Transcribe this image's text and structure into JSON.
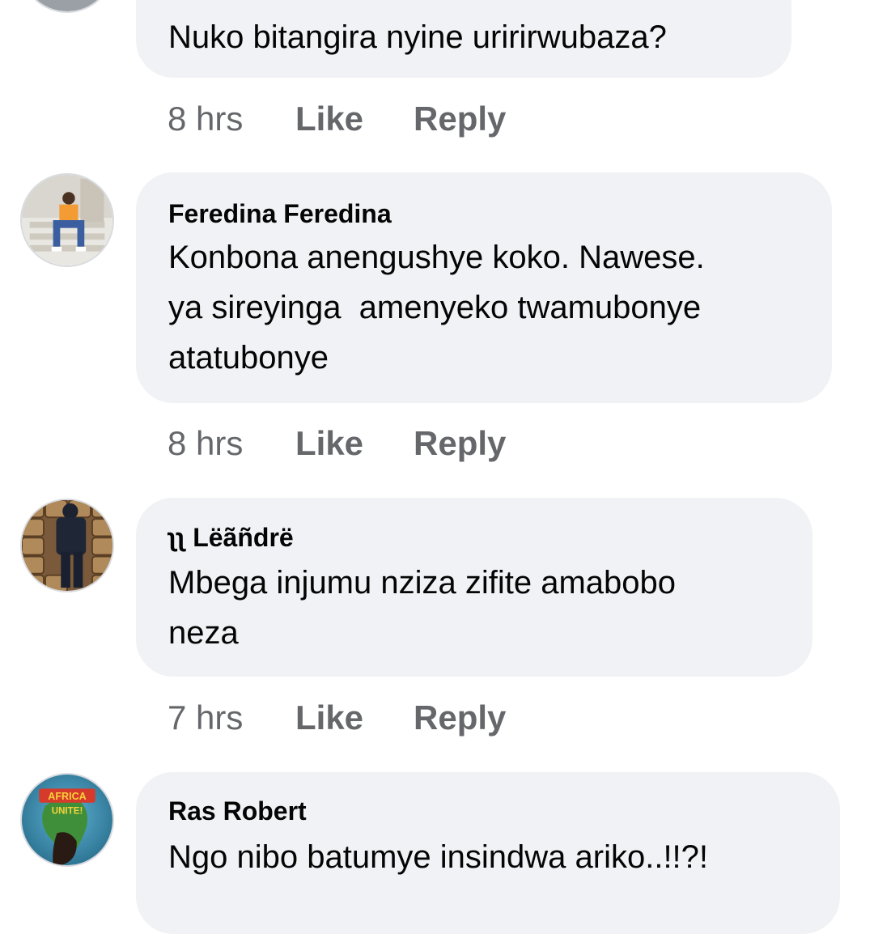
{
  "comments": [
    {
      "author": "",
      "text": "Nuko bitangira nyine uririrwubaza?",
      "time": "8 hrs",
      "like": "Like",
      "reply": "Reply"
    },
    {
      "author": "Feredina Feredina",
      "text": "Konbona anengushye koko. Nawese.\nya sireyinga  amenyeko twamubonye\natatubonye",
      "time": "8 hrs",
      "like": "Like",
      "reply": "Reply"
    },
    {
      "author": "ʅʅ Lëãñdrë",
      "text": "Mbega injumu nziza zifite amabobo\nneza",
      "time": "7 hrs",
      "like": "Like",
      "reply": "Reply"
    },
    {
      "author": "Ras Robert",
      "text": "Ngo nibo batumye insindwa ariko..!!?!",
      "time": "",
      "like": "",
      "reply": ""
    }
  ],
  "avatar_badge": {
    "line1": "AFRICA",
    "line2": "UNITE!"
  },
  "colors": {
    "bubble": "#f0f2f5",
    "text": "#050505",
    "meta": "#65676b"
  }
}
